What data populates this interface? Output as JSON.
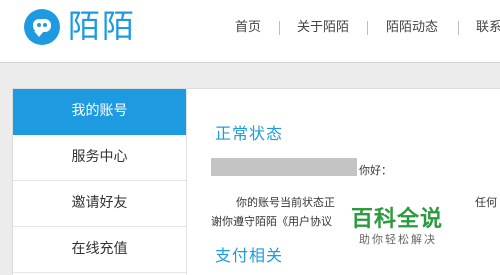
{
  "brand": {
    "name": "陌陌",
    "accent": "#1e9be0"
  },
  "nav": {
    "items": [
      "首页",
      "关于陌陌",
      "陌陌动态",
      "联系"
    ]
  },
  "sidebar": {
    "items": [
      {
        "label": "我的账号",
        "active": true
      },
      {
        "label": "服务中心",
        "active": false
      },
      {
        "label": "邀请好友",
        "active": false
      },
      {
        "label": "在线充值",
        "active": false
      }
    ]
  },
  "content": {
    "status_title": "正常状态",
    "greeting_suffix": "你好：",
    "status_line1_a": "你的账号当前状态正",
    "status_line1_b": "任何",
    "status_line2": "谢你遵守陌陌《用户协议",
    "payment_title": "支付相关"
  },
  "watermark": {
    "title": "百科全说",
    "subtitle": "助你轻松解决"
  }
}
